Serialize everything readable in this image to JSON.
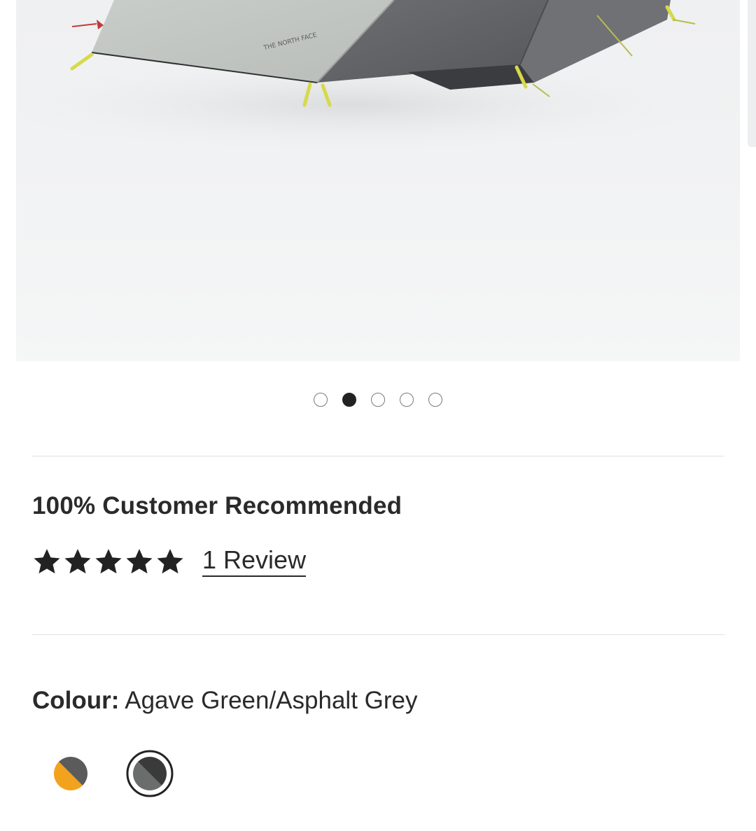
{
  "product": {
    "image_alt": "Tent product image",
    "logo_text": "THE NORTH FACE"
  },
  "carousel": {
    "count": 5,
    "active_index": 1
  },
  "reviews": {
    "headline": "100% Customer Recommended",
    "rating": 5,
    "max_rating": 5,
    "review_link": "1 Review"
  },
  "colour": {
    "label": "Colour:",
    "value": "Agave Green/Asphalt Grey",
    "swatches": [
      {
        "name": "Orange/Asphalt Grey",
        "colors": [
          "#f3a21d",
          "#5b5b5b"
        ],
        "selected": false
      },
      {
        "name": "Agave Green/Asphalt Grey",
        "colors": [
          "#6a6d6b",
          "#3a3a3a"
        ],
        "selected": true
      }
    ]
  },
  "colors": {
    "text": "#2a2a2a",
    "divider": "#e1e1e1",
    "active_dot": "#222222"
  }
}
